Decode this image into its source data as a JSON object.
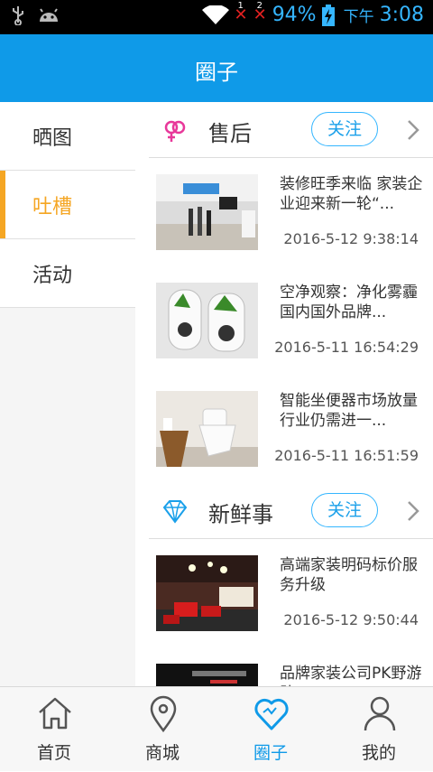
{
  "status_bar": {
    "sim1_label": "1",
    "sim2_label": "2",
    "battery_pct": "94%",
    "ampm": "下午",
    "time": "3:08"
  },
  "header": {
    "title": "圈子"
  },
  "sidebar": {
    "items": [
      {
        "label": "晒图",
        "active": false
      },
      {
        "label": "吐槽",
        "active": true
      },
      {
        "label": "活动",
        "active": false
      }
    ]
  },
  "sections": [
    {
      "title": "售后",
      "icon": "gender-symbol-icon",
      "follow_label": "关注",
      "articles": [
        {
          "title": "装修旺季来临 家装企业迎来新一轮“...",
          "time": "2016-5-12 9:38:14"
        },
        {
          "title": "空净观察：净化雾霾国内国外品牌...",
          "time": "2016-5-11 16:54:29"
        },
        {
          "title": "智能坐便器市场放量 行业仍需进一...",
          "time": "2016-5-11 16:51:59"
        }
      ]
    },
    {
      "title": "新鲜事",
      "icon": "diamond-icon",
      "follow_label": "关注",
      "articles": [
        {
          "title": "高端家装明码标价服务升级",
          "time": "2016-5-12 9:50:44"
        },
        {
          "title": "品牌家装公司PK野游队",
          "time": ""
        }
      ]
    }
  ],
  "tabbar": {
    "items": [
      {
        "label": "首页",
        "icon": "home-icon",
        "active": false
      },
      {
        "label": "商城",
        "icon": "location-pin-icon",
        "active": false
      },
      {
        "label": "圈子",
        "icon": "heart-icon",
        "active": true
      },
      {
        "label": "我的",
        "icon": "user-icon",
        "active": false
      }
    ]
  },
  "colors": {
    "accent": "#0f9ae8",
    "active_side": "#f5a623",
    "follow_border": "#35b6ff"
  }
}
